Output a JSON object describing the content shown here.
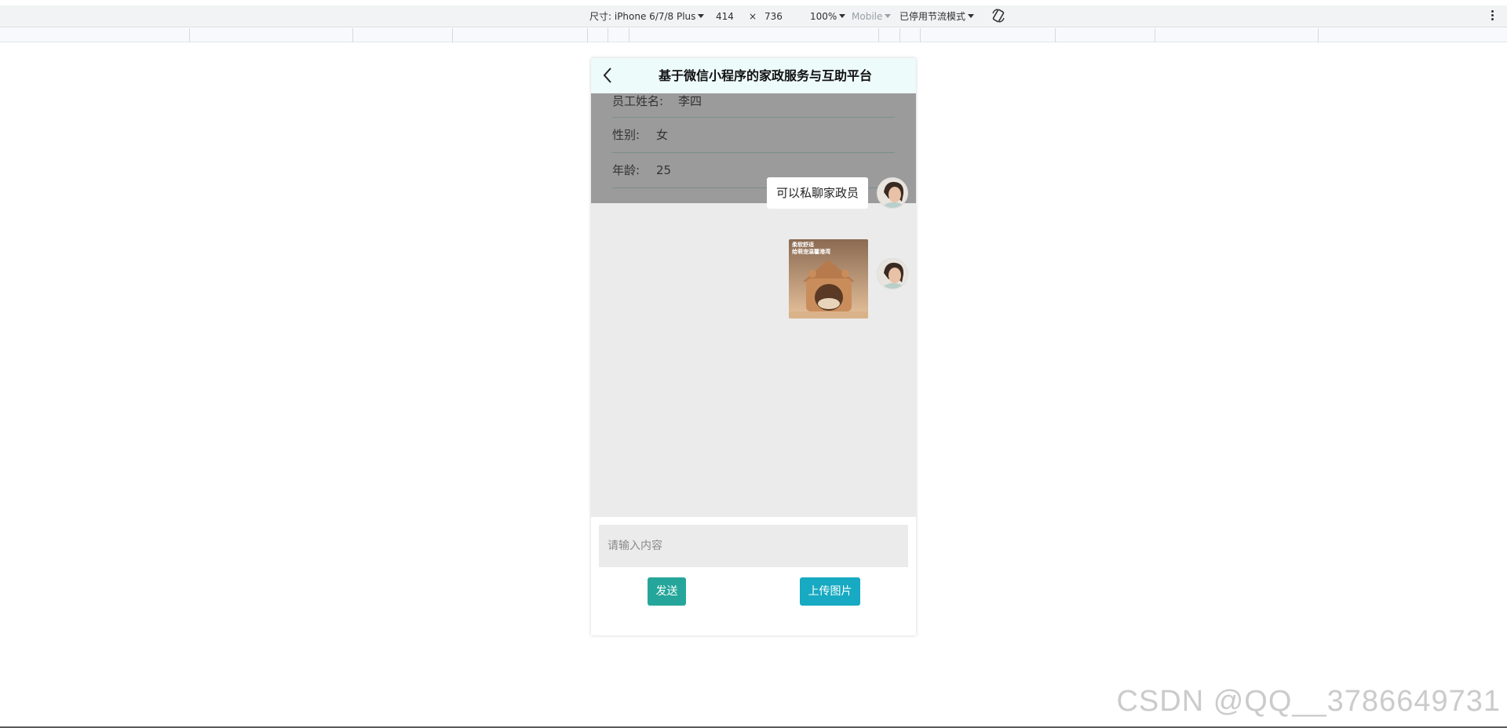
{
  "devtools": {
    "device_label": "尺寸: iPhone 6/7/8 Plus",
    "width": "414",
    "times": "×",
    "height": "736",
    "zoom": "100%",
    "mobile": "Mobile",
    "throttle": "已停用节流模式"
  },
  "nav": {
    "title": "基于微信小程序的家政服务与互助平台"
  },
  "employee": {
    "name_label": "员工姓名:",
    "name_value": "李四",
    "gender_label": "性别:",
    "gender_value": "女",
    "age_label": "年龄:",
    "age_value": "25"
  },
  "messages": [
    {
      "type": "text",
      "text": "可以私聊家政员"
    },
    {
      "type": "image",
      "caption_line1": "柔软舒适",
      "caption_line2": "给萌宠温馨港湾"
    }
  ],
  "composer": {
    "placeholder": "请输入内容",
    "send_label": "发送",
    "upload_label": "上传图片"
  },
  "watermark": "CSDN @QQ__3786649731",
  "colors": {
    "send_button": "#26a69a",
    "upload_button": "#17aac2",
    "nav_bg": "#eefbfb",
    "chat_bg": "#ebebeb"
  }
}
